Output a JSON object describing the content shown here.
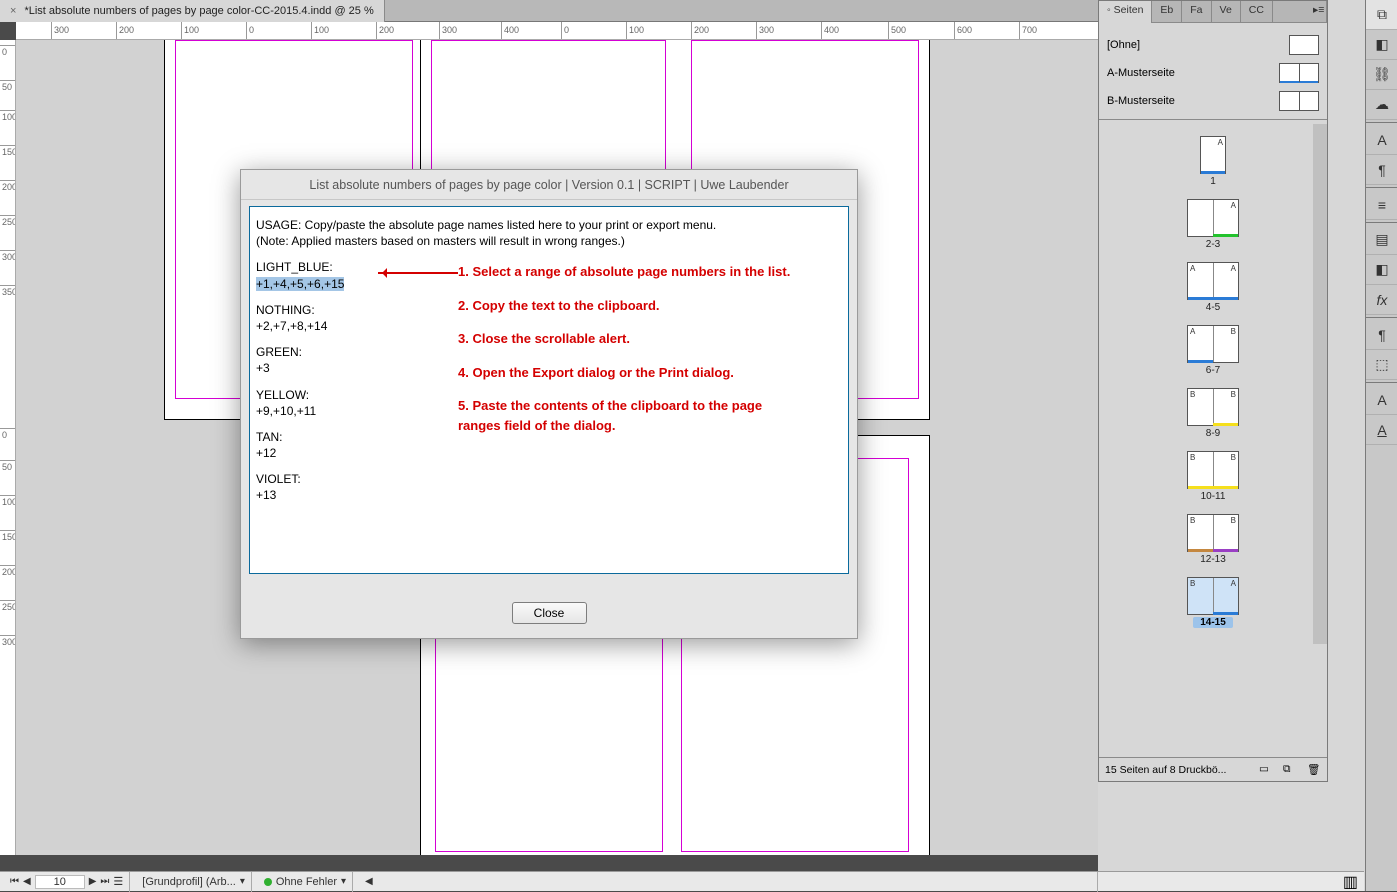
{
  "docTab": {
    "title": "*List absolute numbers of pages by page color-CC-2015.4.indd @ 25 %"
  },
  "dialog": {
    "title": "List absolute numbers of pages by page color | Version 0.1 | SCRIPT | Uwe Laubender",
    "usage1": "USAGE: Copy/paste the absolute page names listed here to your print or export menu.",
    "usage2": "(Note: Applied masters based on masters will result in wrong ranges.)",
    "groups": [
      {
        "name": "LIGHT_BLUE:",
        "range": "+1,+4,+5,+6,+15",
        "selected": true
      },
      {
        "name": "NOTHING:",
        "range": "+2,+7,+8,+14"
      },
      {
        "name": "GREEN:",
        "range": "+3"
      },
      {
        "name": "YELLOW:",
        "range": "+9,+10,+11"
      },
      {
        "name": "TAN:",
        "range": "+12"
      },
      {
        "name": "VIOLET:",
        "range": "+13"
      }
    ],
    "closeLabel": "Close"
  },
  "anno": {
    "s1": "1. Select a range of absolute page numbers in the list.",
    "s2": "2. Copy the text to the clipboard.",
    "s3": "3. Close the scrollable alert.",
    "s4": "4. Open the Export dialog or the Print dialog.",
    "s5": "5. Paste the contents of the clipboard to the page ranges field of the dialog."
  },
  "hrulerTicks": [
    "300",
    "200",
    "100",
    "0",
    "100",
    "200",
    "300",
    "400",
    "0",
    "100",
    "200",
    "300",
    "400",
    "500",
    "600",
    "700"
  ],
  "vrulerTicks": [
    "0",
    "50",
    "100",
    "150",
    "200",
    "250",
    "300",
    "350",
    "0",
    "50",
    "100",
    "150",
    "200",
    "250",
    "300"
  ],
  "pagesPanel": {
    "tabs": [
      "Seiten",
      "Eb",
      "Fa",
      "Ve",
      "CC"
    ],
    "masters": [
      {
        "name": "[Ohne]",
        "thumb": "single"
      },
      {
        "name": "A-Musterseite",
        "thumb": "double-blue"
      },
      {
        "name": "B-Musterseite",
        "thumb": "double"
      }
    ],
    "pages": [
      {
        "num": "1",
        "single": true,
        "ll": "",
        "lr": "A",
        "bar": "#2a7bd6"
      },
      {
        "num": "2-3",
        "ll": "",
        "lr": "A",
        "bar": "#23c22d",
        "barSide": "right"
      },
      {
        "num": "4-5",
        "ll": "A",
        "lr": "A",
        "bar": "#2a7bd6"
      },
      {
        "num": "6-7",
        "ll": "A",
        "lr": "B",
        "bar": "#2a7bd6",
        "barSide": "left"
      },
      {
        "num": "8-9",
        "ll": "B",
        "lr": "B",
        "bar": "#f5df1d",
        "barSide": "right"
      },
      {
        "num": "10-11",
        "ll": "B",
        "lr": "B",
        "bar": "#f5df1d"
      },
      {
        "num": "12-13",
        "ll": "B",
        "lr": "B",
        "bar": "#c4873f",
        "bar2": "#9a3fc4"
      },
      {
        "num": "14-15",
        "ll": "B",
        "lr": "A",
        "bar": "#2a7bd6",
        "barSide": "right",
        "selected": true
      }
    ],
    "footer": "15 Seiten auf 8 Druckbö..."
  },
  "statusBar": {
    "page": "10",
    "profile": "[Grundprofil] (Arb...",
    "errors": "Ohne Fehler"
  }
}
